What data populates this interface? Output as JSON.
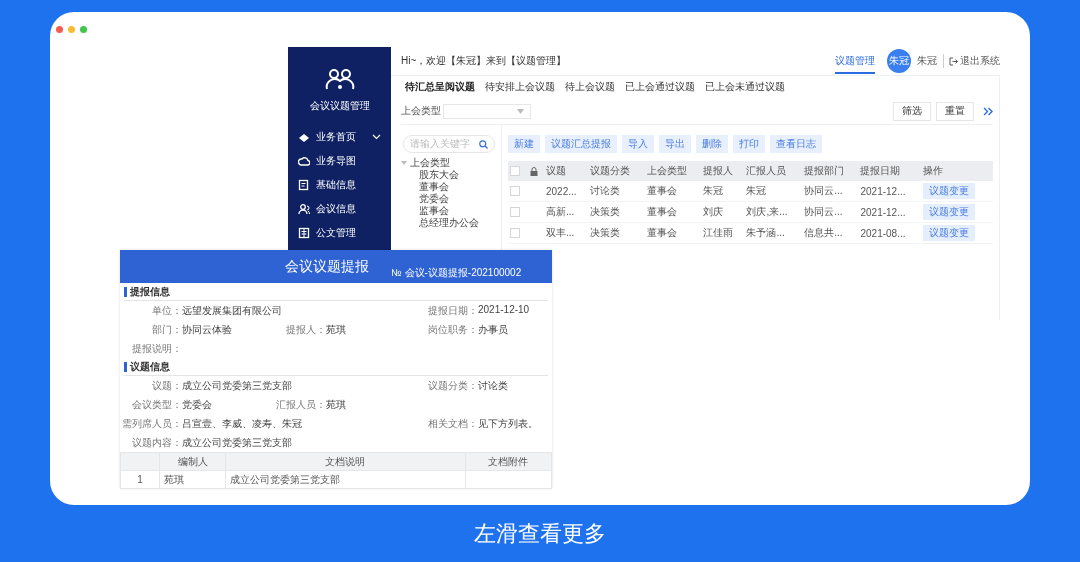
{
  "app": {
    "sidebar": {
      "title": "会议议题管理",
      "items": [
        {
          "label": "业务首页",
          "expandable": true
        },
        {
          "label": "业务导图",
          "expandable": false
        },
        {
          "label": "基础信息",
          "expandable": false
        },
        {
          "label": "会议信息",
          "expandable": false
        },
        {
          "label": "公文管理",
          "expandable": false
        }
      ]
    },
    "header": {
      "greeting": "Hi~，欢迎【朱冠】来到【议题管理】",
      "nav": [
        {
          "label": "议题管理",
          "selected": true
        }
      ],
      "avatar": "朱冠",
      "user": "朱冠",
      "logout": "退出系统"
    },
    "tabs": [
      {
        "label": "待汇总呈阅议题",
        "selected": true
      },
      {
        "label": "待安排上会议题",
        "selected": false
      },
      {
        "label": "待上会议题",
        "selected": false
      },
      {
        "label": "已上会通过议题",
        "selected": false
      },
      {
        "label": "已上会未通过议题",
        "selected": false
      }
    ],
    "filter": {
      "label": "上会类型",
      "buttons": [
        "筛选",
        "重置"
      ]
    },
    "tree": {
      "search_placeholder": "请输入关键字",
      "nodes": [
        {
          "label": "上会类型",
          "expanded": true,
          "children": [
            {
              "label": "股东大会"
            },
            {
              "label": "董事会"
            },
            {
              "label": "党委会"
            },
            {
              "label": "监事会"
            },
            {
              "label": "总经理办公会"
            }
          ]
        }
      ]
    },
    "toolbar": [
      "新建",
      "议题汇总提报",
      "导入",
      "导出",
      "删除",
      "打印",
      "查看日志"
    ],
    "table": {
      "header_checked": false,
      "columns": [
        "议题",
        "议题分类",
        "上会类型",
        "提报人",
        "汇报人员",
        "提报部门",
        "提报日期",
        "操作"
      ],
      "rows": [
        {
          "checked": false,
          "cells": [
            "2022...",
            "讨论类",
            "董事会",
            "朱冠",
            "朱冠",
            "协同云...",
            "2021-12..."
          ],
          "action": "议题变更"
        },
        {
          "checked": false,
          "cells": [
            "高新...",
            "决策类",
            "董事会",
            "刘庆",
            "刘庆,来...",
            "协同云...",
            "2021-12..."
          ],
          "action": "议题变更"
        },
        {
          "checked": false,
          "cells": [
            "双丰...",
            "决策类",
            "董事会",
            "江佳雨",
            "朱予涵...",
            "信息共...",
            "2021-08..."
          ],
          "action": "议题变更"
        }
      ]
    }
  },
  "form": {
    "title": "会议议题提报",
    "number": "№  会议-议题提报-202100002",
    "sections": [
      {
        "heading": "提报信息",
        "rows": [
          [
            {
              "label": "单位：",
              "value": "远望发展集团有限公司"
            },
            "",
            {
              "label": "提报日期：",
              "value": "2021-12-10"
            }
          ],
          [
            {
              "label": "部门：",
              "value": "协同云体验"
            },
            {
              "label": "提报人：",
              "value": "苑琪"
            },
            {
              "label": "岗位职务：",
              "value": "办事员"
            }
          ],
          [
            {
              "label": "提报说明："
            },
            "",
            ""
          ]
        ]
      },
      {
        "heading": "议题信息",
        "rows": [
          [
            {
              "label": "议题：",
              "value": "成立公司党委第三党支部"
            },
            "",
            {
              "label": "议题分类：",
              "value": "讨论类"
            }
          ],
          [
            {
              "label": "会议类型：",
              "value": "党委会"
            },
            {
              "label": "汇报人员：",
              "value": "苑琪"
            },
            ""
          ],
          [
            {
              "label": "需列席人员：",
              "value": "吕宣壹、李威、凌寿、朱冠"
            },
            "",
            {
              "label": "相关文档：",
              "value": "见下方列表。"
            }
          ],
          [
            {
              "label": "议题内容：",
              "value": "成立公司党委第三党支部"
            },
            "",
            ""
          ]
        ]
      }
    ],
    "doc_table": {
      "columns": [
        "",
        "编制人",
        "文档说明",
        "文档附件"
      ],
      "rows": [
        [
          "1",
          "苑琪",
          "成立公司党委第三党支部",
          ""
        ]
      ]
    }
  },
  "caption": "左滑查看更多"
}
